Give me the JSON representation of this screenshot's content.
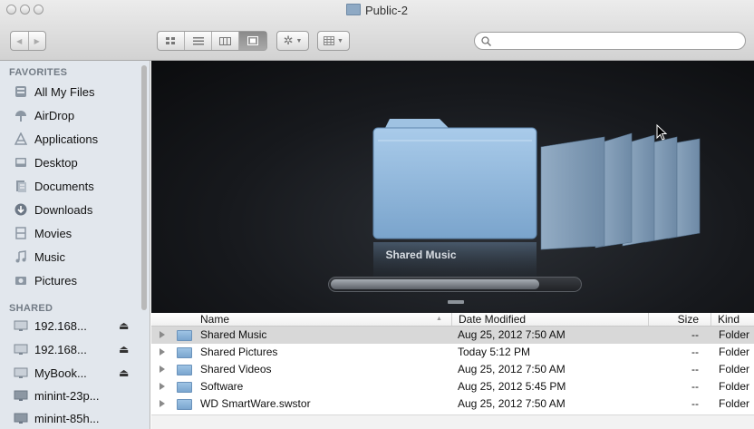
{
  "window": {
    "title": "Public-2"
  },
  "toolbar": {
    "back_label": "◀",
    "forward_label": "▶",
    "search_placeholder": "",
    "view_buttons": [
      "icon",
      "list",
      "column",
      "cover-flow"
    ],
    "active_view": "cover-flow"
  },
  "sidebar": {
    "favorites_heading": "FAVORITES",
    "favorites": [
      {
        "label": "All My Files",
        "icon": "all-files-icon"
      },
      {
        "label": "AirDrop",
        "icon": "airdrop-icon"
      },
      {
        "label": "Applications",
        "icon": "applications-icon"
      },
      {
        "label": "Desktop",
        "icon": "desktop-icon"
      },
      {
        "label": "Documents",
        "icon": "documents-icon"
      },
      {
        "label": "Downloads",
        "icon": "downloads-icon"
      },
      {
        "label": "Movies",
        "icon": "movies-icon"
      },
      {
        "label": "Music",
        "icon": "music-icon"
      },
      {
        "label": "Pictures",
        "icon": "pictures-icon"
      }
    ],
    "shared_heading": "SHARED",
    "shared": [
      {
        "label": "192.168...",
        "eject": "⏏"
      },
      {
        "label": "192.168...",
        "eject": "⏏"
      },
      {
        "label": "MyBook...",
        "eject": "⏏"
      },
      {
        "label": "minint-23p..."
      },
      {
        "label": "minint-85h..."
      }
    ]
  },
  "coverflow": {
    "caption": "Shared Music"
  },
  "list": {
    "columns": {
      "name": "Name",
      "date": "Date Modified",
      "size": "Size",
      "kind": "Kind"
    },
    "rows": [
      {
        "name": "Shared Music",
        "date": "Aug 25, 2012 7:50 AM",
        "size": "--",
        "kind": "Folder",
        "selected": true
      },
      {
        "name": "Shared Pictures",
        "date": "Today 5:12 PM",
        "size": "--",
        "kind": "Folder"
      },
      {
        "name": "Shared Videos",
        "date": "Aug 25, 2012 7:50 AM",
        "size": "--",
        "kind": "Folder"
      },
      {
        "name": "Software",
        "date": "Aug 25, 2012 5:45 PM",
        "size": "--",
        "kind": "Folder"
      },
      {
        "name": "WD SmartWare.swstor",
        "date": "Aug 25, 2012 7:50 AM",
        "size": "--",
        "kind": "Folder"
      }
    ]
  },
  "colors": {
    "sidebar_bg": "#e2e7ed",
    "coverflow_bg": "#17191d",
    "selected_row": "#d8d8d8",
    "folder_blue": "#8fb6dc"
  }
}
